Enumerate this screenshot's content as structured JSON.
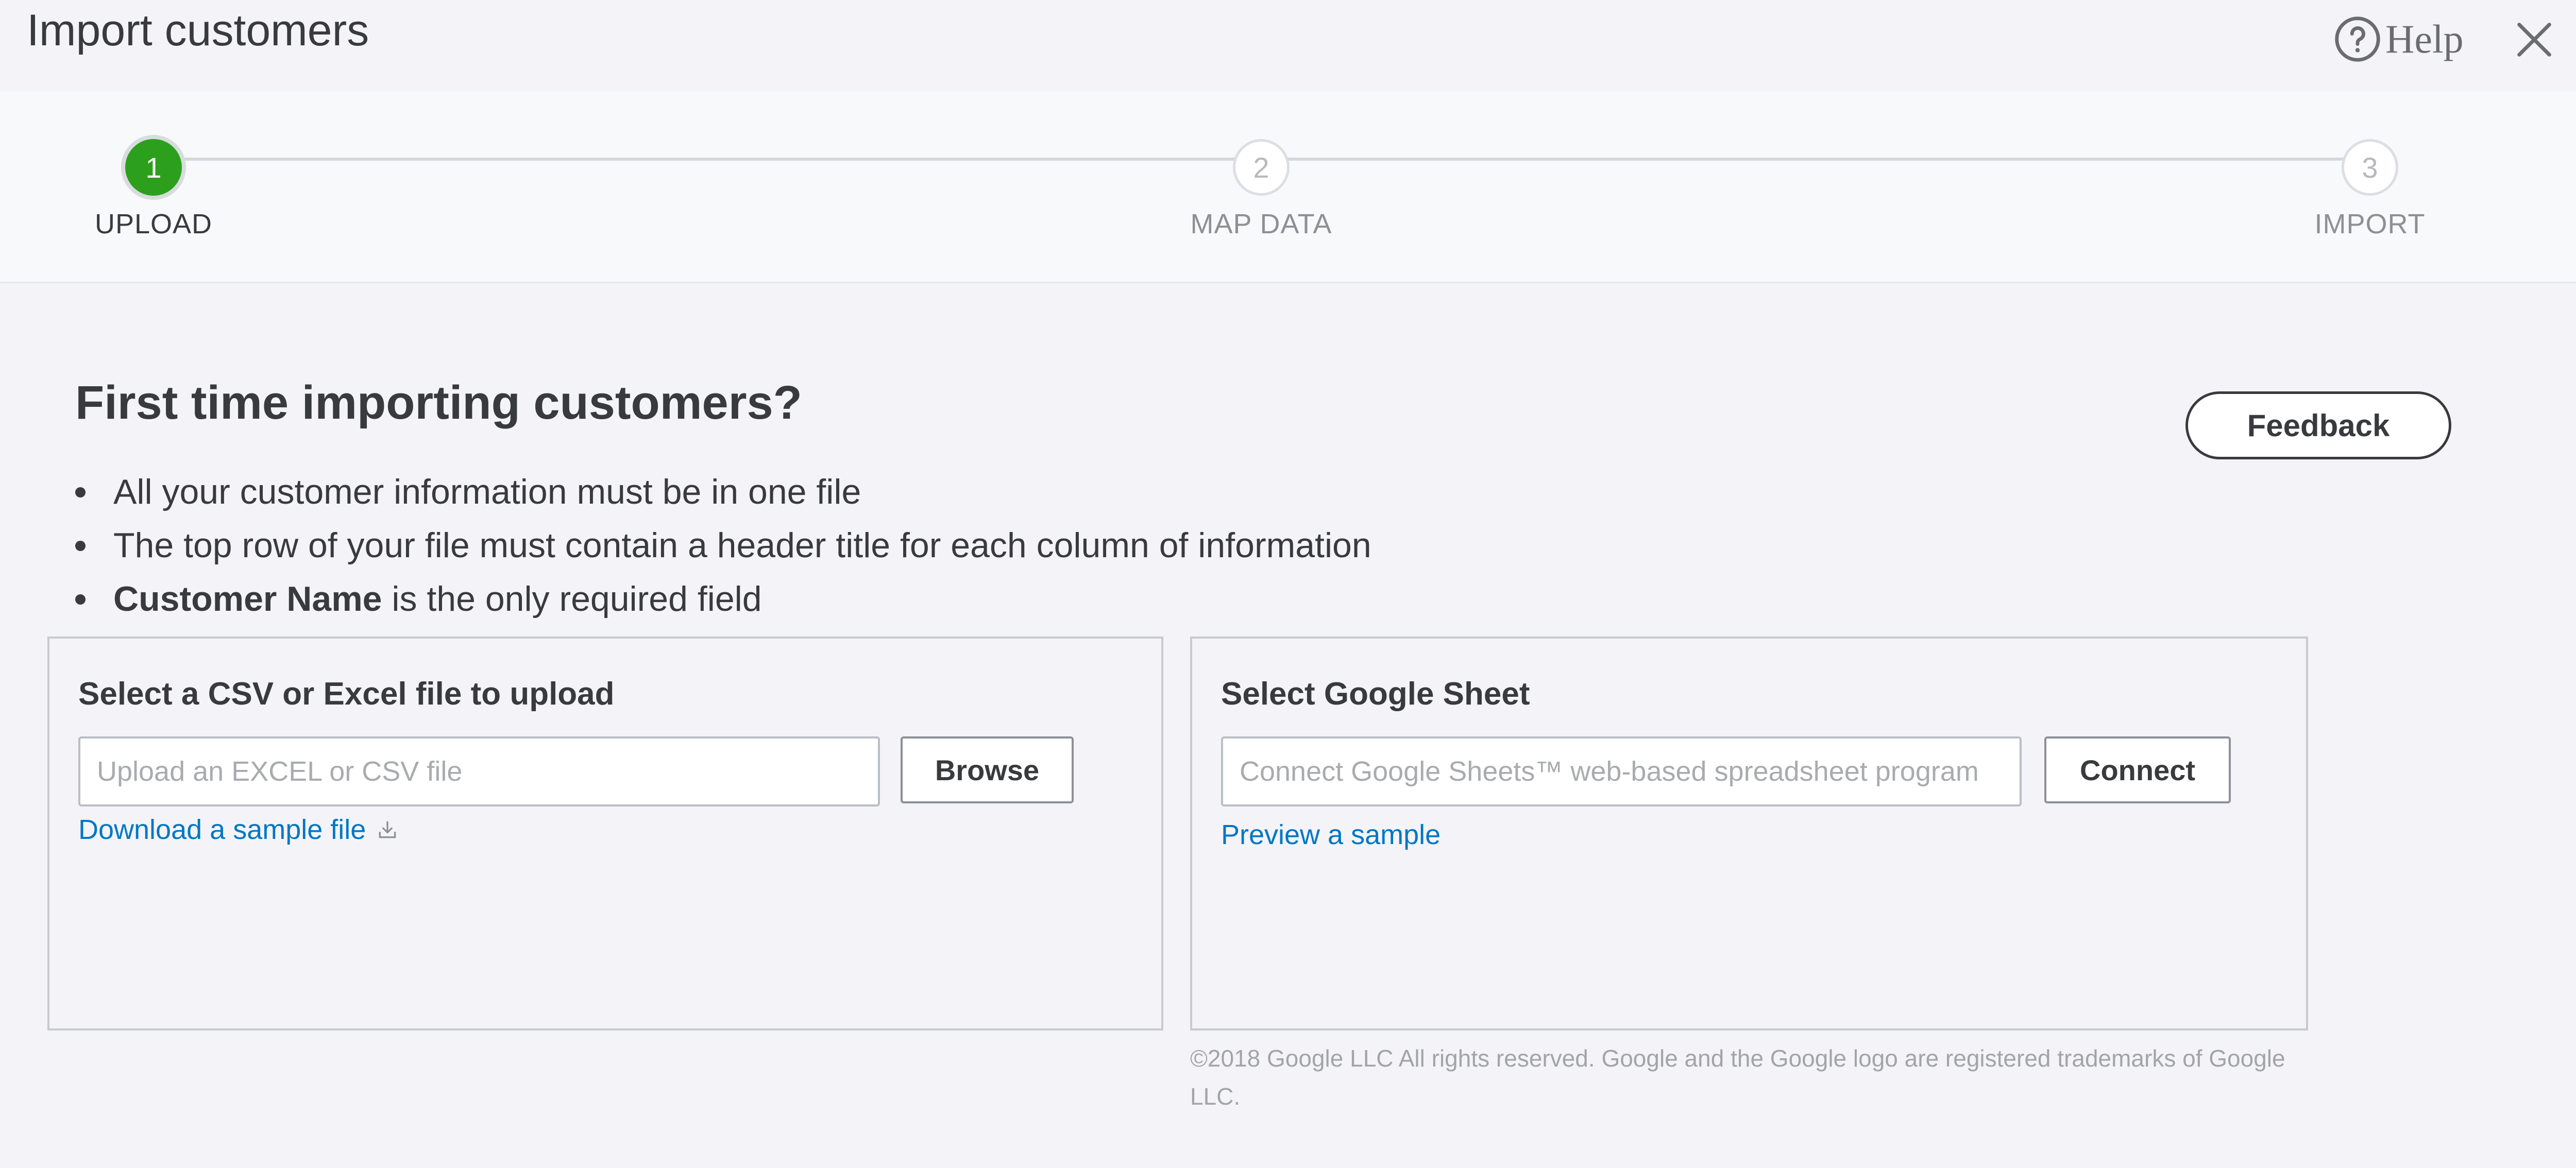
{
  "header": {
    "title": "Import customers",
    "help_label": "Help",
    "help_icon": "question-circle-icon",
    "close_icon": "close-icon"
  },
  "stepper": {
    "steps": [
      {
        "number": "1",
        "label": "UPLOAD",
        "state": "active"
      },
      {
        "number": "2",
        "label": "MAP DATA",
        "state": "inactive"
      },
      {
        "number": "3",
        "label": "IMPORT",
        "state": "inactive"
      }
    ]
  },
  "intro": {
    "title": "First time importing customers?",
    "bullets": [
      "All your customer information must be in one file",
      "The top row of your file must contain a header title for each column of information"
    ],
    "bullet3_bold": "Customer Name",
    "bullet3_rest": " is the only required field"
  },
  "feedback_label": "Feedback",
  "upload_panel": {
    "title": "Select a CSV or Excel file to upload",
    "input_placeholder": "Upload an EXCEL or CSV file",
    "input_value": "",
    "button_label": "Browse",
    "link_label": "Download a sample file",
    "link_icon": "download-icon"
  },
  "sheets_panel": {
    "title": "Select Google Sheet",
    "input_placeholder": "Connect Google Sheets™ web-based spreadsheet program",
    "input_value": "",
    "button_label": "Connect",
    "link_label": "Preview a sample"
  },
  "copyright": "©2018 Google LLC All rights reserved. Google and the Google logo are registered trademarks of Google LLC.",
  "colors": {
    "accent_green": "#2ca01c",
    "link_blue": "#0077c5",
    "text_dark": "#393a3d",
    "background": "#f4f4f8"
  }
}
